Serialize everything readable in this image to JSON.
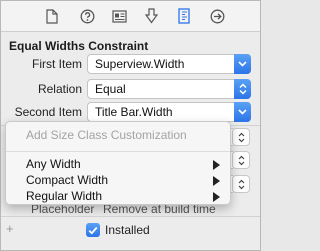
{
  "toolbar": {
    "icons": [
      "file-inspector-icon",
      "quick-help-icon",
      "identity-inspector-icon",
      "attributes-inspector-icon",
      "size-inspector-icon",
      "connections-inspector-icon"
    ],
    "selected": "size-inspector-icon",
    "accent_color": "#2c74e8"
  },
  "section": {
    "title": "Equal Widths Constraint"
  },
  "constraint": {
    "first_item_label": "First Item",
    "first_item_value": "Superview.Width",
    "relation_label": "Relation",
    "relation_value": "Equal",
    "second_item_label": "Second Item",
    "second_item_value": "Title Bar.Width"
  },
  "context_menu": {
    "header": "Add Size Class Customization",
    "items": [
      {
        "label": "Any Width"
      },
      {
        "label": "Compact Width"
      },
      {
        "label": "Regular Width"
      }
    ]
  },
  "obscured": {
    "placeholder_label": "Placeholder",
    "remove_text": "Remove at build time"
  },
  "installed": {
    "label": "Installed",
    "checked": true
  },
  "footer": {
    "add_icon": "plus-icon"
  }
}
